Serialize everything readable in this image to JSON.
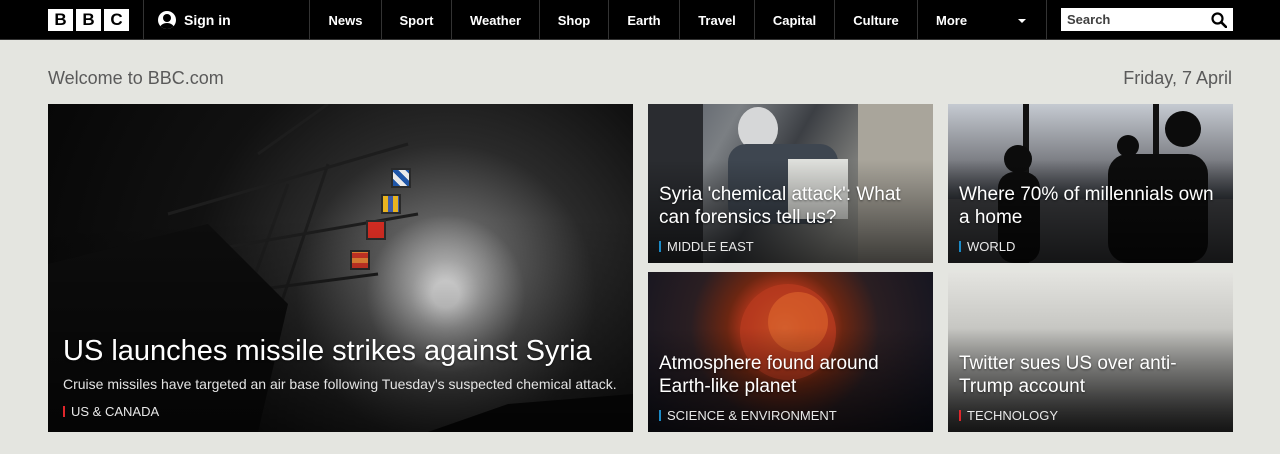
{
  "logo": {
    "letters": [
      "B",
      "B",
      "C"
    ]
  },
  "header": {
    "sign_in": "Sign in",
    "nav": [
      "News",
      "Sport",
      "Weather",
      "Shop",
      "Earth",
      "Travel",
      "Capital",
      "Culture"
    ],
    "more": "More",
    "search_placeholder": "Search"
  },
  "welcome": {
    "text": "Welcome to BBC.com",
    "date": "Friday, 7 April"
  },
  "stories": {
    "hero": {
      "headline": "US launches missile strikes against Syria",
      "summary": "Cruise missiles have targeted an air base following Tuesday's suspected chemical attack.",
      "tag": "US & CANADA",
      "tag_color": "#e0262b"
    },
    "items": [
      {
        "headline": "Syria 'chemical attack': What can forensics tell us?",
        "tag": "MIDDLE EAST",
        "tag_color": "#1b8ac6"
      },
      {
        "headline": "Where 70% of millennials own a home",
        "tag": "WORLD",
        "tag_color": "#1b8ac6"
      },
      {
        "headline": "Atmosphere found around Earth-like planet",
        "tag": "SCIENCE & ENVIRONMENT",
        "tag_color": "#1b8ac6"
      },
      {
        "headline": "Twitter sues US over anti-Trump account",
        "tag": "TECHNOLOGY",
        "tag_color": "#e0262b"
      }
    ]
  },
  "colors": {
    "page_bg": "#e4e5e0",
    "topbar_bg": "#000000"
  }
}
